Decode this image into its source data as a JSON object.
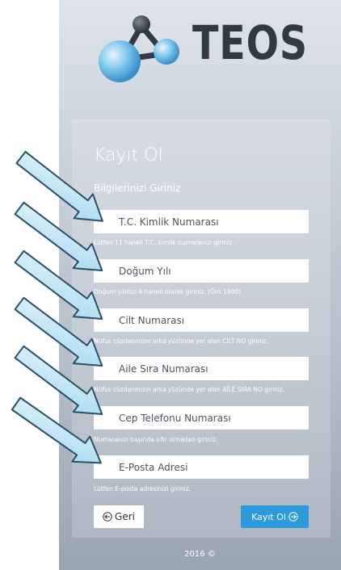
{
  "brand": {
    "name": "TEOS"
  },
  "form": {
    "title": "Kayıt Ol",
    "subtitle": "Bilgilerinizi Giriniz",
    "fields": [
      {
        "placeholder": "T.C. Kimlik Numarası",
        "hint": "Lütfen 11 haneli T.C. kimlik numaranızı giriniz."
      },
      {
        "placeholder": "Doğum Yılı",
        "hint": "Doğum yılınızı 4 haneli olarak giriniz. (Örn 1900)"
      },
      {
        "placeholder": "Cilt Numarası",
        "hint": "Nüfus cüzdanınızın arka yüzünde yer alan CİLT NO giriniz."
      },
      {
        "placeholder": "Aile Sıra Numarası",
        "hint": "Nüfus cüzdanınızın arka yüzünde yer alan AİLE SIRA NO giriniz."
      },
      {
        "placeholder": "Cep Telefonu Numarası",
        "hint": "Numaranızı başında sıfır olmadan giriniz."
      },
      {
        "placeholder": "E-Posta Adresi",
        "hint": "Lütfen E-posta adresinizi giriniz."
      }
    ],
    "back_label": "Geri",
    "submit_label": "Kayıt Ol"
  },
  "footer": {
    "text": "2016 ©"
  },
  "icons": {
    "back": "back-circle-icon",
    "submit": "forward-circle-icon"
  },
  "colors": {
    "accent": "#2b9bdc",
    "arrow": "#bfe4f5"
  }
}
